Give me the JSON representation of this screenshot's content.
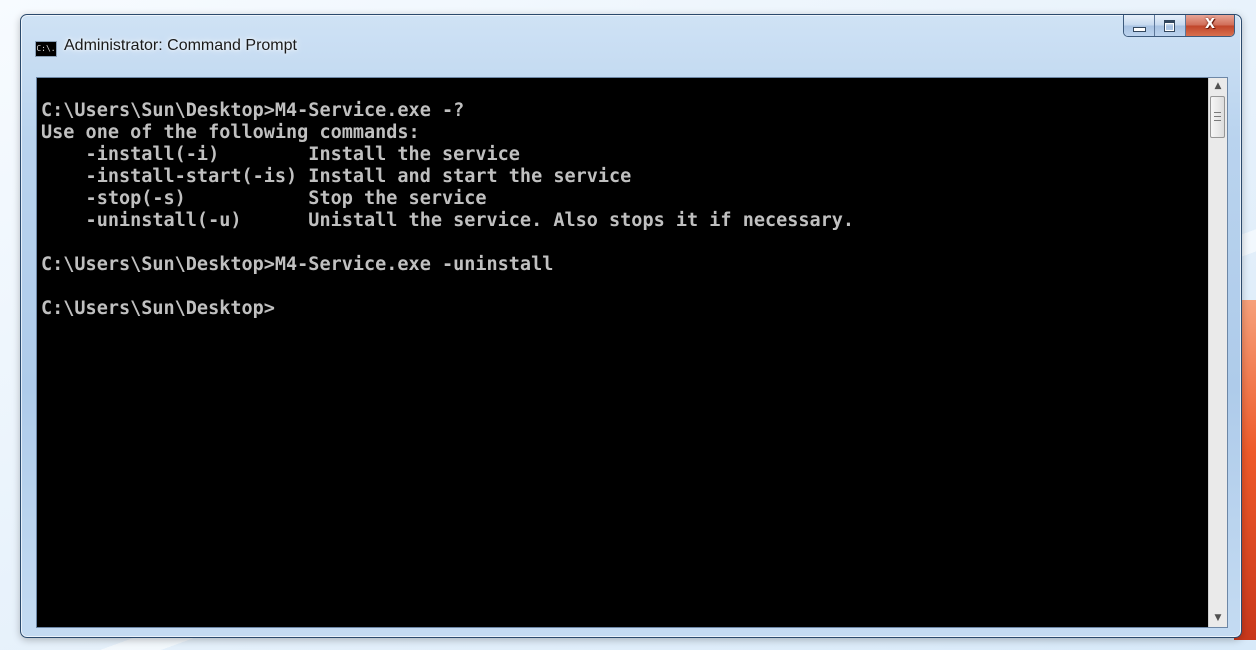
{
  "window": {
    "title": "Administrator: Command Prompt",
    "icon": "cmd-icon",
    "icon_text": "C:\\.",
    "buttons": {
      "minimize": "minimize-icon",
      "maximize": "maximize-icon",
      "close": "close-icon",
      "close_glyph": "X"
    }
  },
  "console": {
    "lines": [
      "C:\\Users\\Sun\\Desktop>M4-Service.exe -?",
      "Use one of the following commands:",
      "    -install(-i)        Install the service",
      "    -install-start(-is) Install and start the service",
      "    -stop(-s)           Stop the service",
      "    -uninstall(-u)      Unistall the service. Also stops it if necessary.",
      "",
      "C:\\Users\\Sun\\Desktop>M4-Service.exe -uninstall",
      "",
      "C:\\Users\\Sun\\Desktop>"
    ]
  },
  "scrollbar": {
    "up_icon": "scroll-up-arrow-icon",
    "down_icon": "scroll-down-arrow-icon",
    "up_glyph": "▲",
    "down_glyph": "▼"
  }
}
